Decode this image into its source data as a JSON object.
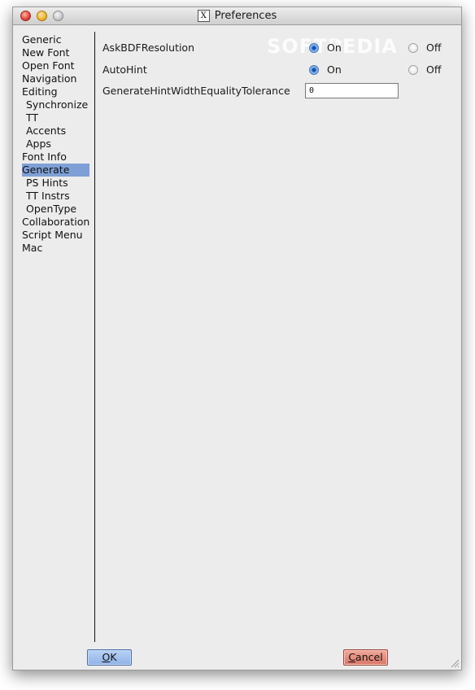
{
  "window": {
    "title": "Preferences",
    "app_icon": "x11-icon"
  },
  "sidebar": {
    "items": [
      {
        "label": "Generic",
        "indent": false,
        "selected": false
      },
      {
        "label": "New Font",
        "indent": false,
        "selected": false
      },
      {
        "label": "Open Font",
        "indent": false,
        "selected": false
      },
      {
        "label": "Navigation",
        "indent": false,
        "selected": false
      },
      {
        "label": "Editing",
        "indent": false,
        "selected": false
      },
      {
        "label": "Synchronize",
        "indent": true,
        "selected": false
      },
      {
        "label": "TT",
        "indent": true,
        "selected": false
      },
      {
        "label": "Accents",
        "indent": true,
        "selected": false
      },
      {
        "label": "Apps",
        "indent": true,
        "selected": false
      },
      {
        "label": "Font Info",
        "indent": false,
        "selected": false
      },
      {
        "label": "Generate",
        "indent": false,
        "selected": true
      },
      {
        "label": "PS Hints",
        "indent": true,
        "selected": false
      },
      {
        "label": "TT Instrs",
        "indent": true,
        "selected": false
      },
      {
        "label": "OpenType",
        "indent": true,
        "selected": false
      },
      {
        "label": "Collaboration",
        "indent": false,
        "selected": false
      },
      {
        "label": "Script Menu",
        "indent": false,
        "selected": false
      },
      {
        "label": "Mac",
        "indent": false,
        "selected": false
      }
    ]
  },
  "settings": {
    "ask_bdf": {
      "label": "AskBDFResolution",
      "on_label": "On",
      "off_label": "Off",
      "value": "On"
    },
    "autohint": {
      "label": "AutoHint",
      "on_label": "On",
      "off_label": "Off",
      "value": "On"
    },
    "tolerance": {
      "label": "GenerateHintWidthEqualityTolerance",
      "value": "0"
    }
  },
  "watermark": "SOFTPEDIA",
  "buttons": {
    "ok_mnemonic": "O",
    "ok_rest": "K",
    "cancel_mnemonic": "C",
    "cancel_rest": "ancel"
  }
}
